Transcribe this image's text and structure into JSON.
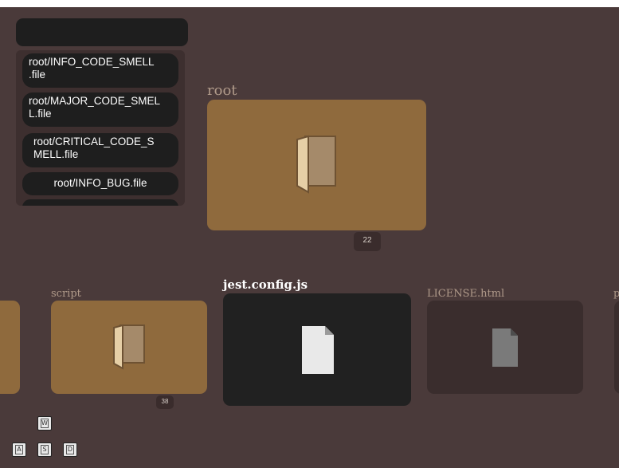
{
  "search": {
    "placeholder": ""
  },
  "issues": [
    "root/INFO_CODE_SMELL.file",
    "root/MAJOR_CODE_SMELL.file",
    "root/CRITICAL_CODE_SMELL.file",
    "root/INFO_BUG.file"
  ],
  "issue_lines": [
    [
      "root/INFO_CODE_SMELL",
      ".file"
    ],
    [
      "root/MAJOR_CODE_SMEL",
      "L.file"
    ],
    [
      "root/CRITICAL_CODE_S",
      "MELL.file"
    ]
  ],
  "nodes": {
    "root": {
      "label": "root",
      "count": "22"
    },
    "script": {
      "label": "script",
      "count": "38"
    },
    "jest": {
      "label": "jest.config.js"
    },
    "license": {
      "label": "LICENSE.html"
    },
    "partial": {
      "label": "p"
    }
  },
  "keys": [
    "W",
    "A",
    "S",
    "D"
  ],
  "colors": {
    "background": "#4a3a3a",
    "folder": "#8f6a3d",
    "selected": "#212121",
    "file_dim": "#3a2d2d"
  }
}
